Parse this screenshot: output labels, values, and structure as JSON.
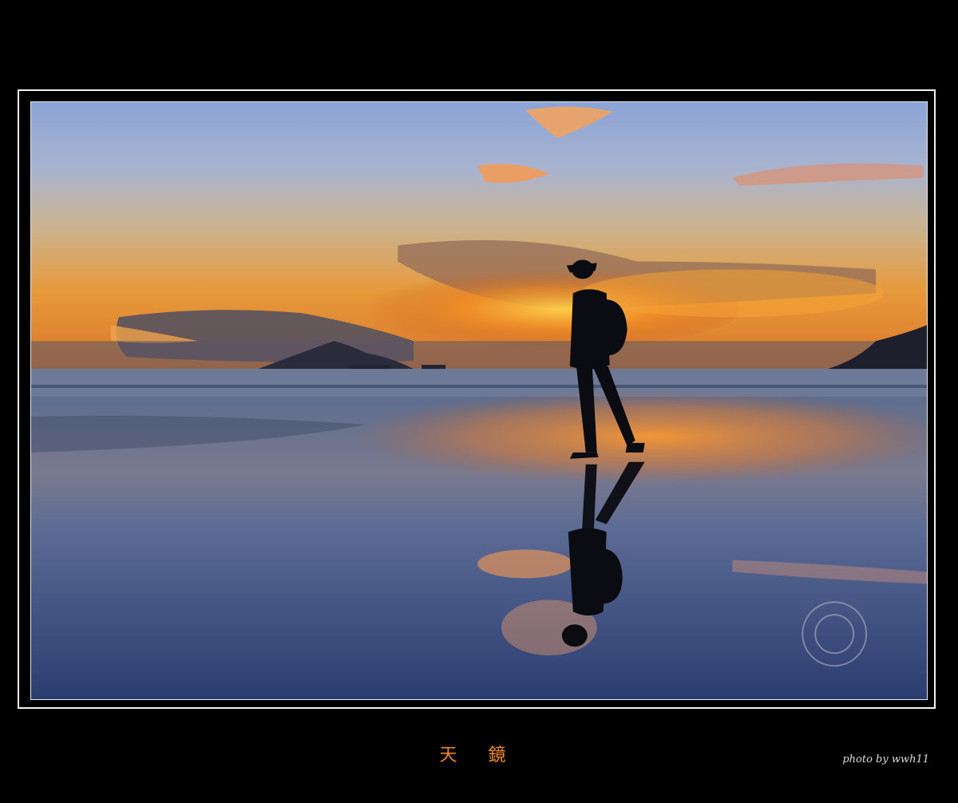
{
  "caption": "天 鏡",
  "credit": "photo by wwh11",
  "watermark": "PHOTO BY WWH11",
  "colors": {
    "background": "#000000",
    "frame": "#f2f2f2",
    "caption": "#f08a2a",
    "credit": "#dcdcdc"
  }
}
